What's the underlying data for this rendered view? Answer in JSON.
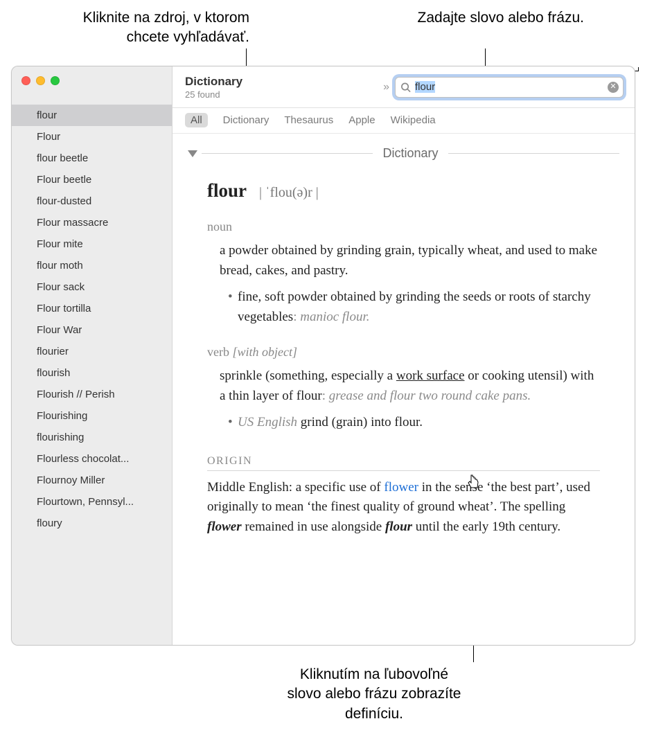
{
  "callouts": {
    "source": "Kliknite na zdroj, v ktorom chcete vyhľadávať.",
    "search": "Zadajte slovo alebo frázu.",
    "click_word": "Kliknutím na ľubovoľné slovo alebo frázu zobrazíte definíciu."
  },
  "toolbar": {
    "title": "Dictionary",
    "subtitle": "25 found",
    "overflow_glyph": "»"
  },
  "search": {
    "value": "flour",
    "clear_glyph": "✕"
  },
  "tabs": [
    "All",
    "Dictionary",
    "Thesaurus",
    "Apple",
    "Wikipedia"
  ],
  "section_label": "Dictionary",
  "sidebar_items": [
    "flour",
    "Flour",
    "flour beetle",
    "Flour beetle",
    "flour-dusted",
    "Flour massacre",
    "Flour mite",
    "flour moth",
    "Flour sack",
    "Flour tortilla",
    "Flour War",
    "flourier",
    "flourish",
    "Flourish // Perish",
    "Flourishing",
    "flourishing",
    "Flourless chocolat...",
    "Flournoy Miller",
    "Flourtown, Pennsyl...",
    "floury"
  ],
  "entry": {
    "headword": "flour",
    "pronunciation": "| ˈflou(ə)r |",
    "pos_noun": "noun",
    "def_noun": "a powder obtained by grinding grain, typically wheat, and used to make bread, cakes, and pastry",
    "sub_noun": "fine, soft powder obtained by grinding the seeds or roots of starchy vegetables",
    "sub_noun_example": "manioc flour.",
    "pos_verb": "verb",
    "verb_qualifier": "[with object]",
    "def_verb_pre": "sprinkle (something, especially a ",
    "def_verb_link": "work surface",
    "def_verb_post": " or cooking utensil) with a thin layer of flour",
    "def_verb_example": "grease and flour two round cake pans.",
    "sub_verb_region": "US English",
    "sub_verb": "grind (grain) into flour",
    "origin_head": "ORIGIN",
    "origin_pre": "Middle English: a specific use of ",
    "origin_link": "flower",
    "origin_mid1": " in the sense ‘the best part’, used originally to mean ‘the finest quality of ground wheat’. The spelling ",
    "origin_bold1": "flower",
    "origin_mid2": " remained in use alongside ",
    "origin_bold2": "flour",
    "origin_end": " until the early 19th century."
  }
}
